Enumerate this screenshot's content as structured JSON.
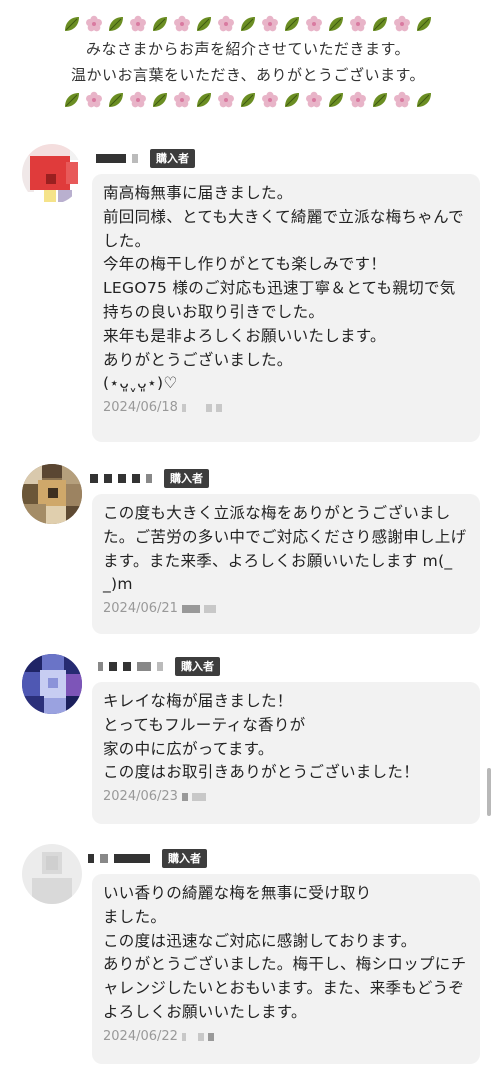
{
  "header": {
    "decoration_icons": [
      "leaf-icon",
      "flower-icon",
      "leaf-icon",
      "flower-icon",
      "leaf-icon",
      "flower-icon",
      "leaf-icon",
      "flower-icon",
      "leaf-icon",
      "flower-icon",
      "leaf-icon",
      "flower-icon",
      "leaf-icon",
      "flower-icon",
      "leaf-icon",
      "flower-icon",
      "leaf-icon"
    ],
    "line1": "みなさまからお声を紹介させていただきます。",
    "line2": "温かいお言葉をいただき、ありがとうございます。"
  },
  "colors": {
    "leaf": "#6b8e23",
    "flower": "#e8b4c8",
    "badge_bg": "#3d3d3d",
    "bubble_bg": "#f2f2f2"
  },
  "reviews": [
    {
      "badge": "購入者",
      "text": "南高梅無事に届きました。\n前回同様、とても大きくて綺麗で立派な梅ちゃんでした。\n今年の梅干し作りがとても楽しみです！\nLEGO75 様のご対応も迅速丁寧＆とても親切で気持ちの良いお取り引きでした。\n来年も是非よろしくお願いいたします。\nありがとうございました。\n(⋆ᴗ͈ˬᴗ͈⋆)♡",
      "date": "2024/06/18"
    },
    {
      "badge": "購入者",
      "text": "この度も大きく立派な梅をありがとうございました。ご苦労の多い中でご対応くださり感謝申し上げます。また来季、よろしくお願いいたします m(_ _)m",
      "date": "2024/06/21"
    },
    {
      "badge": "購入者",
      "text": "キレイな梅が届きました！\nとってもフルーティな香りが\n家の中に広がってます。\nこの度はお取引きありがとうございました！",
      "date": "2024/06/23"
    },
    {
      "badge": "購入者",
      "text": "いい香りの綺麗な梅を無事に受け取り\nました。\nこの度は迅速なご対応に感謝しております。\nありがとうございました。梅干し、梅シロップにチャレンジしたいとおもいます。また、来季もどうぞよろしくお願いいたします。",
      "date": "2024/06/22"
    }
  ]
}
